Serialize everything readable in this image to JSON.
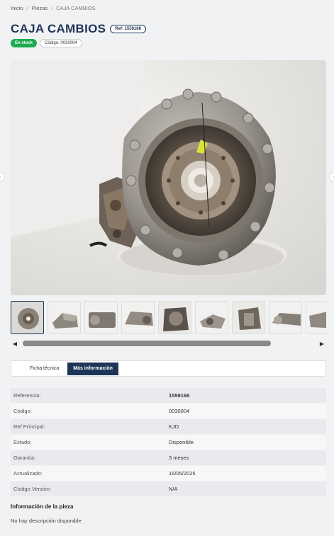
{
  "breadcrumb": {
    "home": "Inicio",
    "parts": "Piezas",
    "current": "CAJA CAMBIOS",
    "separator": "/"
  },
  "product": {
    "title": "CAJA CAMBIOS",
    "ref_pill": "Ref: 1559168",
    "stock_badge": "En stock",
    "code_badge": "Código: 0030004"
  },
  "gallery": {
    "prev_icon": "chevron-left-icon",
    "next_icon": "chevron-right-icon",
    "thumbnail_count": 9,
    "active_thumbnail": 1
  },
  "tabs": [
    {
      "label": "Ficha técnica",
      "active": false
    },
    {
      "label": "Más información",
      "active": true
    }
  ],
  "specs": [
    {
      "label": "Referencia:",
      "value": "1559168"
    },
    {
      "label": "Código:",
      "value": "0030004"
    },
    {
      "label": "Ref Principal:",
      "value": "KJD"
    },
    {
      "label": "Estado:",
      "value": "Disponible"
    },
    {
      "label": "Garantía:",
      "value": "3 meses"
    },
    {
      "label": "Actualizado:",
      "value": "16/05/2025"
    },
    {
      "label": "Código Versión:",
      "value": "N/A"
    }
  ],
  "info": {
    "title": "Información de la pieza",
    "text": "No hay descripción disponible"
  },
  "colors": {
    "brand": "#1d3557",
    "stock": "#1bab50",
    "background": "#f1f2f4"
  }
}
